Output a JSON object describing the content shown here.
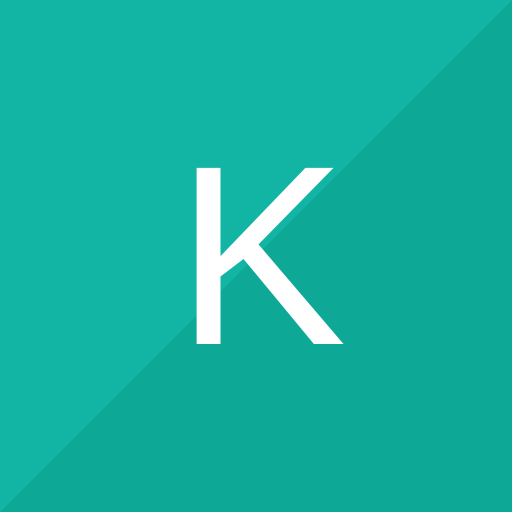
{
  "avatar": {
    "initial": "K",
    "background_color": "#12b5a3",
    "shade_color": "#0ea897",
    "text_color": "#ffffff"
  }
}
